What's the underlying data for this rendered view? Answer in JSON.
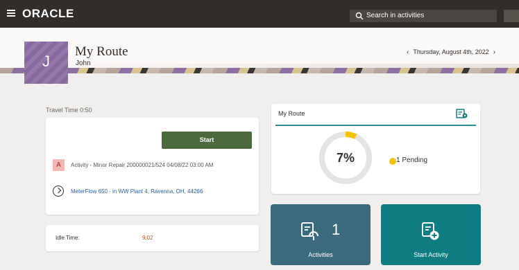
{
  "app": {
    "logo_text": "ORACLE",
    "search_placeholder": "Search in activities"
  },
  "header": {
    "avatar_initial": "J",
    "title": "My Route",
    "user_name": "John",
    "date_text": "Thursday, August 4th, 2022",
    "prev_label": "‹",
    "next_label": "›"
  },
  "left": {
    "travel_time": "Travel Time 0:50",
    "start_label": "Start",
    "activity_badge": "A",
    "activity_text": "Activity - Minor Repair 200000021/524 04/08/22 03:00 AM",
    "address_text": "MeterFlow 650 - in WW Plant 4, Ravenna, OH, 44266",
    "idle_label": "Idle Time:",
    "idle_value": "9:02"
  },
  "route_card": {
    "title": "My Route",
    "percent_text": "7%",
    "progress_fraction": 0.07,
    "pending_text": "1 Pending"
  },
  "tiles": {
    "activities_count": "1",
    "activities_label": "Activities",
    "start_activity_label": "Start Activity"
  },
  "colors": {
    "topbar": "#312d2a",
    "start_button": "#4b6b3c",
    "accent_teal": "#2f8b8b",
    "pending": "#f5c400",
    "tile_activities": "#3a6a7e",
    "tile_start": "#0f7c83",
    "avatar": "#8f6ea8"
  },
  "icons": {
    "menu": "hamburger-menu-icon",
    "search": "search-icon",
    "map": "route-map-icon",
    "location": "navigation-icon",
    "activities": "activity-list-icon",
    "start": "add-activity-icon"
  }
}
